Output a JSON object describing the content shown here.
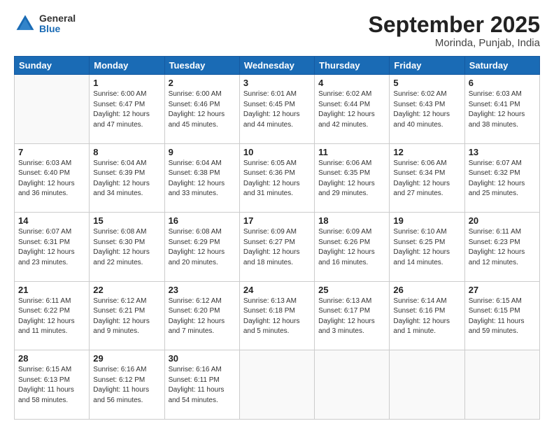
{
  "header": {
    "logo_general": "General",
    "logo_blue": "Blue",
    "month": "September 2025",
    "location": "Morinda, Punjab, India"
  },
  "days_of_week": [
    "Sunday",
    "Monday",
    "Tuesday",
    "Wednesday",
    "Thursday",
    "Friday",
    "Saturday"
  ],
  "weeks": [
    [
      {
        "day": "",
        "info": ""
      },
      {
        "day": "1",
        "info": "Sunrise: 6:00 AM\nSunset: 6:47 PM\nDaylight: 12 hours\nand 47 minutes."
      },
      {
        "day": "2",
        "info": "Sunrise: 6:00 AM\nSunset: 6:46 PM\nDaylight: 12 hours\nand 45 minutes."
      },
      {
        "day": "3",
        "info": "Sunrise: 6:01 AM\nSunset: 6:45 PM\nDaylight: 12 hours\nand 44 minutes."
      },
      {
        "day": "4",
        "info": "Sunrise: 6:02 AM\nSunset: 6:44 PM\nDaylight: 12 hours\nand 42 minutes."
      },
      {
        "day": "5",
        "info": "Sunrise: 6:02 AM\nSunset: 6:43 PM\nDaylight: 12 hours\nand 40 minutes."
      },
      {
        "day": "6",
        "info": "Sunrise: 6:03 AM\nSunset: 6:41 PM\nDaylight: 12 hours\nand 38 minutes."
      }
    ],
    [
      {
        "day": "7",
        "info": "Sunrise: 6:03 AM\nSunset: 6:40 PM\nDaylight: 12 hours\nand 36 minutes."
      },
      {
        "day": "8",
        "info": "Sunrise: 6:04 AM\nSunset: 6:39 PM\nDaylight: 12 hours\nand 34 minutes."
      },
      {
        "day": "9",
        "info": "Sunrise: 6:04 AM\nSunset: 6:38 PM\nDaylight: 12 hours\nand 33 minutes."
      },
      {
        "day": "10",
        "info": "Sunrise: 6:05 AM\nSunset: 6:36 PM\nDaylight: 12 hours\nand 31 minutes."
      },
      {
        "day": "11",
        "info": "Sunrise: 6:06 AM\nSunset: 6:35 PM\nDaylight: 12 hours\nand 29 minutes."
      },
      {
        "day": "12",
        "info": "Sunrise: 6:06 AM\nSunset: 6:34 PM\nDaylight: 12 hours\nand 27 minutes."
      },
      {
        "day": "13",
        "info": "Sunrise: 6:07 AM\nSunset: 6:32 PM\nDaylight: 12 hours\nand 25 minutes."
      }
    ],
    [
      {
        "day": "14",
        "info": "Sunrise: 6:07 AM\nSunset: 6:31 PM\nDaylight: 12 hours\nand 23 minutes."
      },
      {
        "day": "15",
        "info": "Sunrise: 6:08 AM\nSunset: 6:30 PM\nDaylight: 12 hours\nand 22 minutes."
      },
      {
        "day": "16",
        "info": "Sunrise: 6:08 AM\nSunset: 6:29 PM\nDaylight: 12 hours\nand 20 minutes."
      },
      {
        "day": "17",
        "info": "Sunrise: 6:09 AM\nSunset: 6:27 PM\nDaylight: 12 hours\nand 18 minutes."
      },
      {
        "day": "18",
        "info": "Sunrise: 6:09 AM\nSunset: 6:26 PM\nDaylight: 12 hours\nand 16 minutes."
      },
      {
        "day": "19",
        "info": "Sunrise: 6:10 AM\nSunset: 6:25 PM\nDaylight: 12 hours\nand 14 minutes."
      },
      {
        "day": "20",
        "info": "Sunrise: 6:11 AM\nSunset: 6:23 PM\nDaylight: 12 hours\nand 12 minutes."
      }
    ],
    [
      {
        "day": "21",
        "info": "Sunrise: 6:11 AM\nSunset: 6:22 PM\nDaylight: 12 hours\nand 11 minutes."
      },
      {
        "day": "22",
        "info": "Sunrise: 6:12 AM\nSunset: 6:21 PM\nDaylight: 12 hours\nand 9 minutes."
      },
      {
        "day": "23",
        "info": "Sunrise: 6:12 AM\nSunset: 6:20 PM\nDaylight: 12 hours\nand 7 minutes."
      },
      {
        "day": "24",
        "info": "Sunrise: 6:13 AM\nSunset: 6:18 PM\nDaylight: 12 hours\nand 5 minutes."
      },
      {
        "day": "25",
        "info": "Sunrise: 6:13 AM\nSunset: 6:17 PM\nDaylight: 12 hours\nand 3 minutes."
      },
      {
        "day": "26",
        "info": "Sunrise: 6:14 AM\nSunset: 6:16 PM\nDaylight: 12 hours\nand 1 minute."
      },
      {
        "day": "27",
        "info": "Sunrise: 6:15 AM\nSunset: 6:15 PM\nDaylight: 11 hours\nand 59 minutes."
      }
    ],
    [
      {
        "day": "28",
        "info": "Sunrise: 6:15 AM\nSunset: 6:13 PM\nDaylight: 11 hours\nand 58 minutes."
      },
      {
        "day": "29",
        "info": "Sunrise: 6:16 AM\nSunset: 6:12 PM\nDaylight: 11 hours\nand 56 minutes."
      },
      {
        "day": "30",
        "info": "Sunrise: 6:16 AM\nSunset: 6:11 PM\nDaylight: 11 hours\nand 54 minutes."
      },
      {
        "day": "",
        "info": ""
      },
      {
        "day": "",
        "info": ""
      },
      {
        "day": "",
        "info": ""
      },
      {
        "day": "",
        "info": ""
      }
    ]
  ]
}
